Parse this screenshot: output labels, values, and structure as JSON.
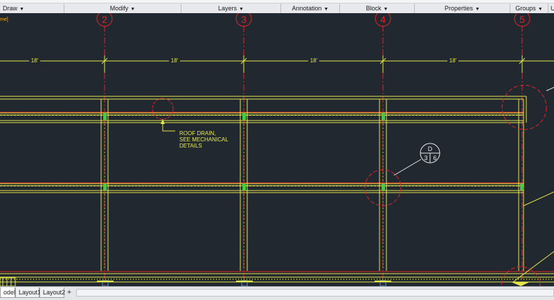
{
  "ribbon": {
    "panels": [
      {
        "label": "Draw"
      },
      {
        "label": "Modify"
      },
      {
        "label": "Layers"
      },
      {
        "label": "Annotation"
      },
      {
        "label": "Block"
      },
      {
        "label": "Properties"
      },
      {
        "label": "Groups"
      },
      {
        "label": "U"
      }
    ]
  },
  "drawing": {
    "view_label": "me]",
    "grid_bubbles": [
      "2",
      "3",
      "4",
      "5"
    ],
    "dimensions": [
      "18'",
      "18'",
      "18'",
      "18'"
    ],
    "roof_drain_note": [
      "ROOF DRAIN,",
      "SEE MECHANICAL",
      "DETAILS"
    ],
    "detail_callout": {
      "letter": "D",
      "number_left": "3",
      "number_right": "6"
    },
    "colors": {
      "background": "#212830",
      "structure_yellow": "#e6e84a",
      "grid_red": "#e0242a",
      "hatch_green": "#3fcf3f",
      "callout_white": "#e6e6e6",
      "label_orange": "#ffb000"
    }
  },
  "tabs": {
    "items": [
      "odel",
      "Layout1",
      "Layout2"
    ],
    "active": "odel",
    "add_icon": "+"
  }
}
